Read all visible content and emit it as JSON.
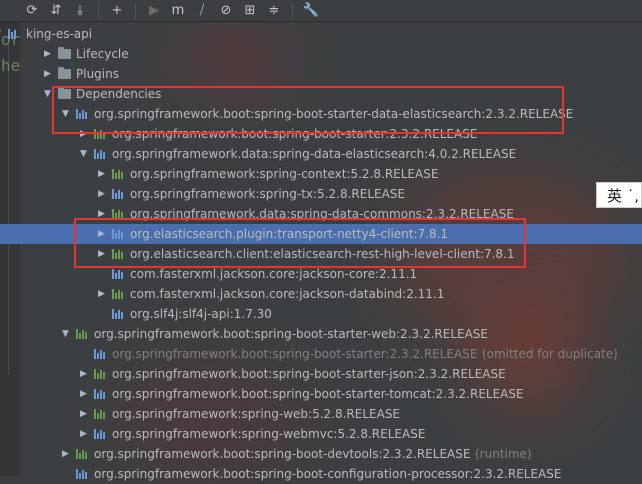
{
  "toolbar": {
    "buttons": [
      {
        "icon": "refresh-icon",
        "glyph": "⟳",
        "disabled": false
      },
      {
        "icon": "reimport-icon",
        "glyph": "⇵",
        "disabled": false
      },
      {
        "icon": "download-icon",
        "glyph": "⤓",
        "disabled": false
      },
      {
        "icon": "add-icon",
        "glyph": "+",
        "disabled": false
      },
      {
        "icon": "run-icon",
        "glyph": "▶",
        "disabled": true
      },
      {
        "icon": "maven-goal-icon",
        "glyph": "m",
        "disabled": false
      },
      {
        "icon": "toggle-offline-icon",
        "glyph": "⧸",
        "disabled": false
      },
      {
        "icon": "skip-tests-icon",
        "glyph": "⊘",
        "disabled": false
      },
      {
        "icon": "show-dependencies-icon",
        "glyph": "⊞",
        "disabled": false
      },
      {
        "icon": "collapse-all-icon",
        "glyph": "≑",
        "disabled": false
      },
      {
        "icon": "settings-wrench-icon",
        "glyph": "🔧",
        "disabled": false
      }
    ]
  },
  "gutter": {
    "line1": "or",
    "line2": "he"
  },
  "tree": [
    {
      "label": "king-es-api",
      "indent": 0,
      "arrow": "down",
      "icon": "project",
      "dim": false,
      "suffix": ""
    },
    {
      "label": "Lifecycle",
      "indent": 1,
      "arrow": "right",
      "icon": "folder",
      "dim": false,
      "suffix": ""
    },
    {
      "label": "Plugins",
      "indent": 1,
      "arrow": "right",
      "icon": "folder",
      "dim": false,
      "suffix": ""
    },
    {
      "label": "Dependencies",
      "indent": 1,
      "arrow": "down",
      "icon": "folder",
      "dim": false,
      "suffix": ""
    },
    {
      "label": "org.springframework.boot:spring-boot-starter-data-elasticsearch:2.3.2.RELEASE",
      "indent": 2,
      "arrow": "down",
      "icon": "dep",
      "dim": false,
      "suffix": ""
    },
    {
      "label": "org.springframework.boot:spring-boot-starter:2.3.2.RELEASE",
      "indent": 3,
      "arrow": "right",
      "icon": "dep",
      "dim": false,
      "suffix": ""
    },
    {
      "label": "org.springframework.data:spring-data-elasticsearch:4.0.2.RELEASE",
      "indent": 3,
      "arrow": "down",
      "icon": "dep",
      "dim": false,
      "suffix": ""
    },
    {
      "label": "org.springframework:spring-context:5.2.8.RELEASE",
      "indent": 4,
      "arrow": "right",
      "icon": "dep",
      "dim": false,
      "suffix": ""
    },
    {
      "label": "org.springframework:spring-tx:5.2.8.RELEASE",
      "indent": 4,
      "arrow": "right",
      "icon": "dep",
      "dim": false,
      "suffix": ""
    },
    {
      "label": "org.springframework.data:spring-data-commons:2.3.2.RELEASE",
      "indent": 4,
      "arrow": "right",
      "icon": "dep",
      "dim": false,
      "suffix": ""
    },
    {
      "label": "org.elasticsearch.plugin:transport-netty4-client:7.8.1",
      "indent": 4,
      "arrow": "right",
      "icon": "dep",
      "dim": false,
      "suffix": "",
      "selected": true
    },
    {
      "label": "org.elasticsearch.client:elasticsearch-rest-high-level-client:7.8.1",
      "indent": 4,
      "arrow": "right",
      "icon": "dep",
      "dim": false,
      "suffix": ""
    },
    {
      "label": "com.fasterxml.jackson.core:jackson-core:2.11.1",
      "indent": 4,
      "arrow": "none",
      "icon": "dep",
      "dim": false,
      "suffix": ""
    },
    {
      "label": "com.fasterxml.jackson.core:jackson-databind:2.11.1",
      "indent": 4,
      "arrow": "right",
      "icon": "dep",
      "dim": false,
      "suffix": ""
    },
    {
      "label": "org.slf4j:slf4j-api:1.7.30",
      "indent": 4,
      "arrow": "none",
      "icon": "dep",
      "dim": false,
      "suffix": ""
    },
    {
      "label": "org.springframework.boot:spring-boot-starter-web:2.3.2.RELEASE",
      "indent": 2,
      "arrow": "down",
      "icon": "dep",
      "dim": false,
      "suffix": ""
    },
    {
      "label": "org.springframework.boot:spring-boot-starter:2.3.2.RELEASE",
      "indent": 3,
      "arrow": "none",
      "icon": "dep",
      "dim": true,
      "suffix": "(omitted for duplicate)"
    },
    {
      "label": "org.springframework.boot:spring-boot-starter-json:2.3.2.RELEASE",
      "indent": 3,
      "arrow": "right",
      "icon": "dep",
      "dim": false,
      "suffix": ""
    },
    {
      "label": "org.springframework.boot:spring-boot-starter-tomcat:2.3.2.RELEASE",
      "indent": 3,
      "arrow": "right",
      "icon": "dep",
      "dim": false,
      "suffix": ""
    },
    {
      "label": "org.springframework:spring-web:5.2.8.RELEASE",
      "indent": 3,
      "arrow": "right",
      "icon": "dep",
      "dim": false,
      "suffix": ""
    },
    {
      "label": "org.springframework:spring-webmvc:5.2.8.RELEASE",
      "indent": 3,
      "arrow": "right",
      "icon": "dep",
      "dim": false,
      "suffix": ""
    },
    {
      "label": "org.springframework.boot:spring-boot-devtools:2.3.2.RELEASE",
      "indent": 2,
      "arrow": "right",
      "icon": "dep",
      "dim": false,
      "suffix": "(runtime)"
    },
    {
      "label": "org.springframework.boot:spring-boot-configuration-processor:2.3.2.RELEASE",
      "indent": 2,
      "arrow": "none",
      "icon": "dep",
      "dim": false,
      "suffix": ""
    }
  ],
  "ime_indicator": "英 ˙,",
  "colors": {
    "selection": "#4b6eaf",
    "highlight_box": "#e53434",
    "text": "#bbbbbb"
  }
}
